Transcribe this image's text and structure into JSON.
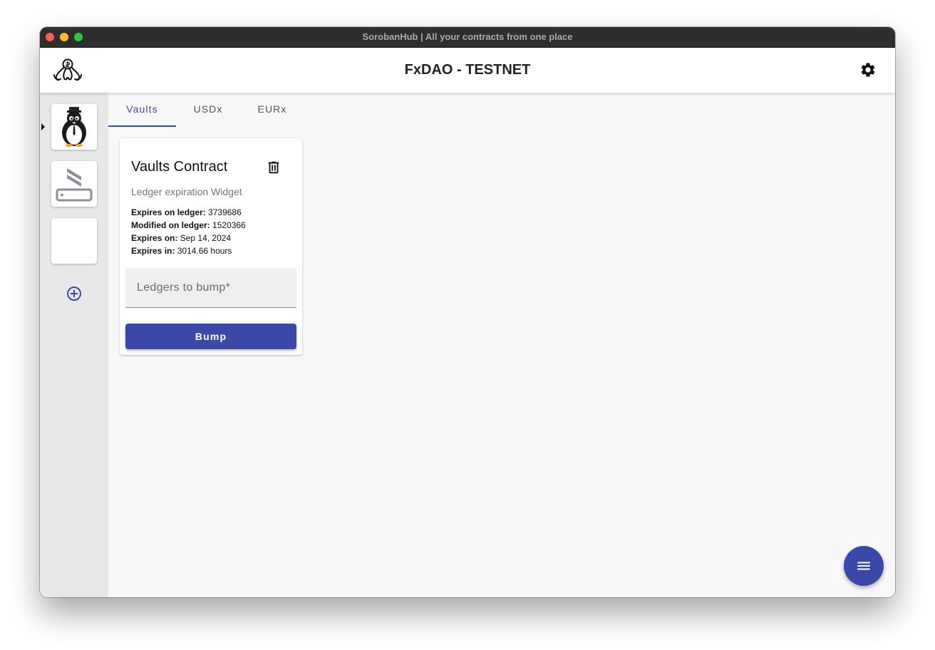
{
  "window": {
    "title": "SorobanHub | All your contracts from one place"
  },
  "appbar": {
    "title": "FxDAO - TESTNET",
    "logo_icon": "octopus-logo-icon",
    "settings_icon": "gear-icon"
  },
  "sidebar": {
    "items": [
      {
        "name": "penguin-project-icon",
        "selected": true
      },
      {
        "name": "stellar-project-icon",
        "selected": false
      },
      {
        "name": "empty-project",
        "selected": false
      }
    ],
    "add_icon": "add-circle-icon"
  },
  "tabs": [
    {
      "label": "Vaults",
      "active": true
    },
    {
      "label": "USDx",
      "active": false
    },
    {
      "label": "EURx",
      "active": false
    }
  ],
  "card": {
    "title": "Vaults Contract",
    "subtitle": "Ledger expiration Widget",
    "rows": [
      {
        "label": "Expires on ledger:",
        "value": "3739686"
      },
      {
        "label": "Modified on ledger:",
        "value": "1520366"
      },
      {
        "label": "Expires on:",
        "value": "Sep 14, 2024"
      },
      {
        "label": "Expires in:",
        "value": "3014.66 hours"
      }
    ],
    "input": {
      "label": "Ledgers to bump*",
      "value": ""
    },
    "button": "Bump"
  },
  "fab": {
    "icon": "menu-icon"
  },
  "colors": {
    "primary": "#3a49a8",
    "titlebar": "#2e2e2e",
    "sidebar": "#e8e8e8",
    "content": "#f8f8f8"
  }
}
